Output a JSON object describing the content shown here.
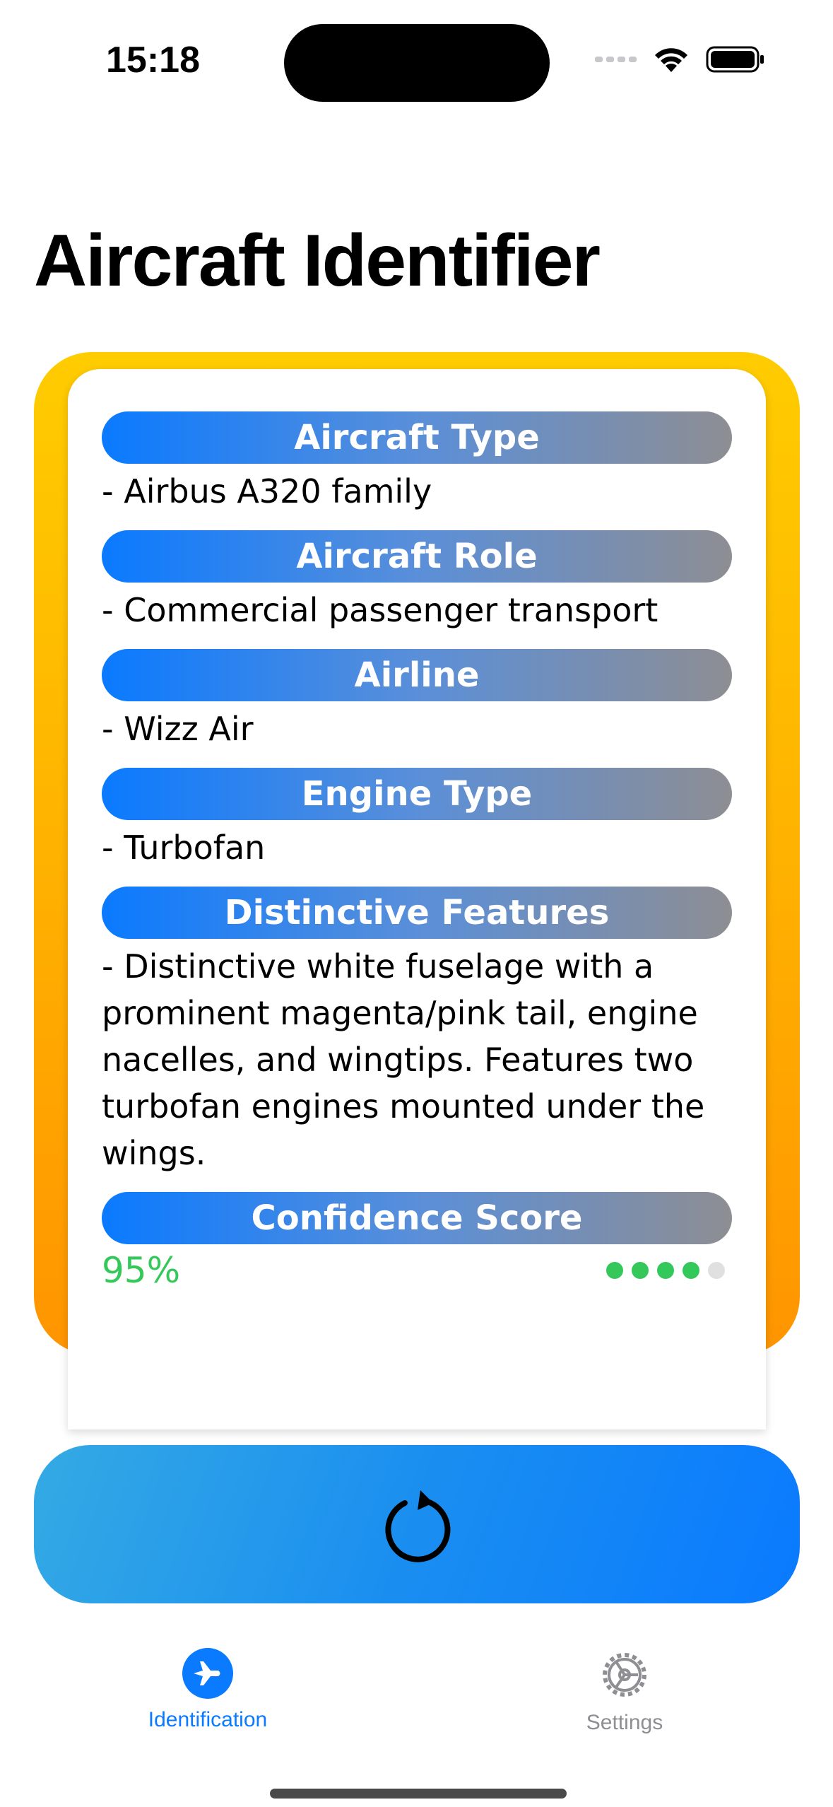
{
  "status_bar": {
    "time": "15:18"
  },
  "title": "Aircraft Identifier",
  "sections": [
    {
      "header": "Aircraft Type",
      "body": "- Airbus A320 family"
    },
    {
      "header": "Aircraft Role",
      "body": "- Commercial passenger transport"
    },
    {
      "header": "Airline",
      "body": "- Wizz Air"
    },
    {
      "header": "Engine Type",
      "body": "- Turbofan"
    },
    {
      "header": "Distinctive Features",
      "body": "- Distinctive white fuselage with a prominent magenta/pink tail, engine nacelles, and wingtips. Features two turbofan engines mounted under the wings."
    }
  ],
  "confidence": {
    "header": "Confidence Score",
    "value": "95%",
    "level_filled": 4,
    "level_total": 5
  },
  "tabs": [
    {
      "label": "Identification",
      "icon": "airplane-icon",
      "active": true
    },
    {
      "label": "Settings",
      "icon": "gear-icon",
      "active": false
    }
  ],
  "colors": {
    "accent": "#0a7aff",
    "confidence_green": "#34c759",
    "inactive_tab": "#8e8e93",
    "card_border_top": "#ffcc00",
    "card_border_bottom": "#ff9500"
  }
}
